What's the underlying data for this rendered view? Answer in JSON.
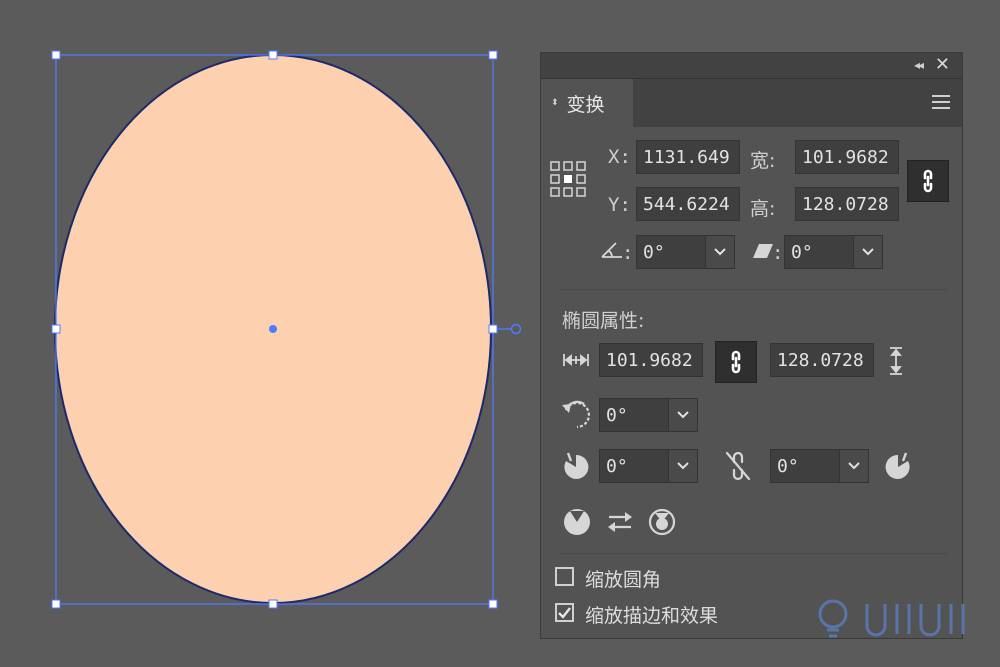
{
  "canvas": {
    "ellipse_fill": "#fdd0b0",
    "ellipse_stroke": "#1c2a6b",
    "selection_color": "#4f7bff"
  },
  "panel": {
    "title": "变换",
    "menu_icon": "hamburger-menu-icon",
    "transform": {
      "x_label": "X:",
      "x_value": "1131.649",
      "y_label": "Y:",
      "y_value": "544.6224",
      "width_label": "宽:",
      "width_value": "101.9682",
      "height_label": "高:",
      "height_value": "128.0728",
      "rotate_value": "0°",
      "shear_value": "0°"
    },
    "ellipse_props": {
      "heading": "椭圆属性:",
      "width_value": "101.9682",
      "height_value": "128.0728",
      "rotation_value": "0°",
      "pie_start_value": "0°",
      "pie_end_value": "0°"
    },
    "options": {
      "scale_corners_label": "缩放圆角",
      "scale_corners_checked": false,
      "scale_strokes_label": "缩放描边和效果",
      "scale_strokes_checked": true
    }
  }
}
